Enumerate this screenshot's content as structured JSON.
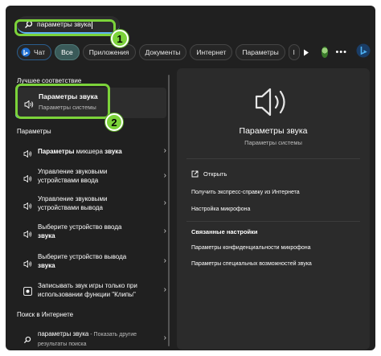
{
  "search": {
    "value": "параметры звука"
  },
  "filters": {
    "chat": "Чат",
    "all": "Все",
    "apps": "Приложения",
    "docs": "Документы",
    "internet": "Интернет",
    "settings": "Параметры",
    "more_char": "l",
    "overflow": "•••"
  },
  "left": {
    "best_header": "Лучшее соответствие",
    "best": {
      "title": "Параметры звука",
      "subtitle": "Параметры системы"
    },
    "settings_header": "Параметры",
    "items": [
      {
        "bold_a": "Параметры",
        "normal": " микшера ",
        "bold_b": "звука"
      },
      {
        "line1": "Управление звуковыми",
        "line2": "устройствами ввода"
      },
      {
        "line1": "Управление звуковыми",
        "line2": "устройствами вывода"
      },
      {
        "line1": "Выберите устройство ввода",
        "bold": "звука"
      },
      {
        "line1": "Выберите устройство вывода",
        "bold": "звука"
      },
      {
        "line1": "Записывать звук игры только при",
        "line2": "использовании функции \"Клипы\""
      }
    ],
    "web_header": "Поиск в Интернете",
    "web": {
      "query": "параметры звука",
      "suffix": " - Показать другие",
      "line2": "результаты поиска"
    }
  },
  "right": {
    "title": "Параметры звука",
    "subtitle": "Параметры системы",
    "open": "Открыть",
    "links": [
      "Получить экспресс-справку из Интернета",
      "Настройка микрофона"
    ],
    "related_header": "Связанные настройки",
    "related": [
      "Параметры конфиденциальности микрофона",
      "Параметры специальных возможностей звука"
    ]
  },
  "annotations": [
    "1",
    "2"
  ],
  "colors": {
    "accent": "#5fb2f2",
    "highlight": "#7cd33a",
    "panel": "#202020"
  }
}
